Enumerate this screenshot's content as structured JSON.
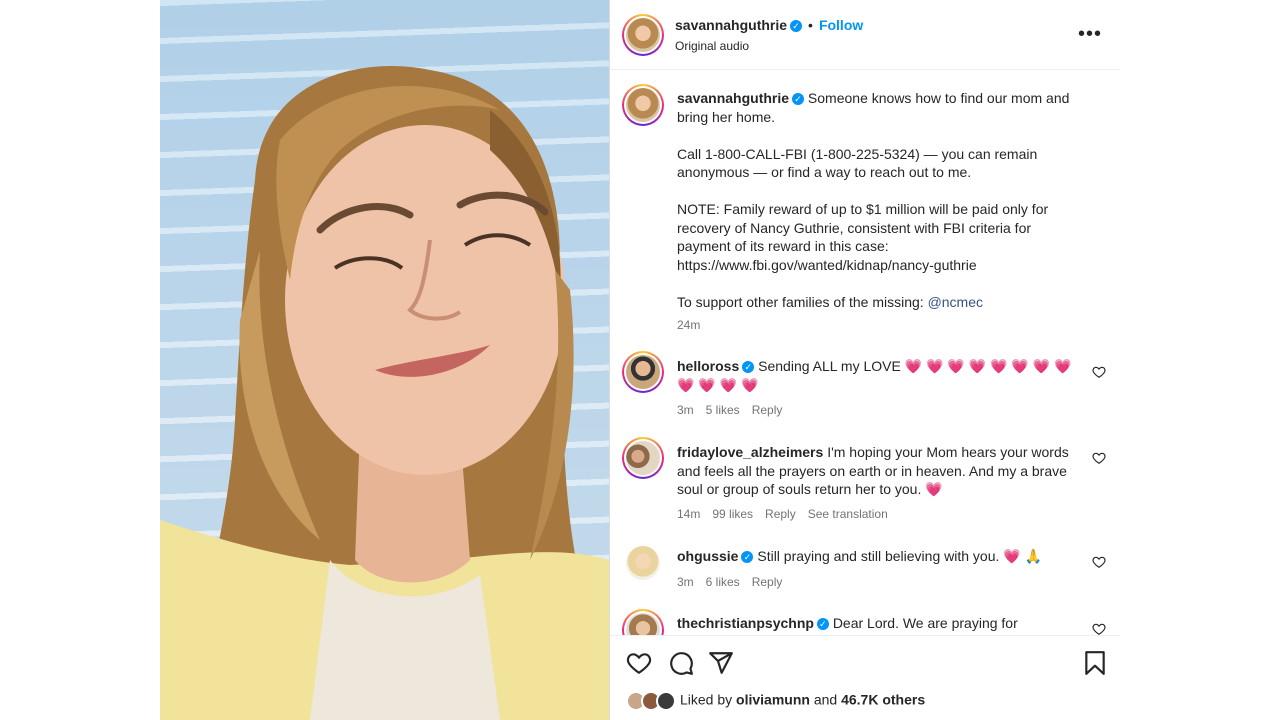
{
  "header": {
    "username": "savannahguthrie",
    "follow_label": "Follow",
    "audio": "Original audio",
    "more_label": "•••"
  },
  "caption": {
    "username": "savannahguthrie",
    "line1": "Someone knows how to find our mom and bring her home.",
    "line2": "Call 1-800-CALL-FBI (1-800-225-5324) — you can remain anonymous — or find a way to reach out to me.",
    "line3": "NOTE: Family reward of up to $1 million will be paid only for recovery of Nancy Guthrie, consistent with FBI criteria for payment of its reward in this case: https://www.fbi.gov/wanted/kidnap/nancy-guthrie",
    "line4_prefix": "To support other families of the missing: ",
    "line4_mention": "@ncmec",
    "time": "24m"
  },
  "comments": [
    {
      "username": "helloross",
      "text": "Sending ALL my LOVE",
      "emojis": "💗 💗 💗 💗 💗 💗 💗 💗 💗 💗 💗 💗",
      "time": "3m",
      "likes": "5 likes",
      "reply": "Reply"
    },
    {
      "username": "fridaylove_alzheimers",
      "text": "I'm hoping your Mom hears your words and feels all the prayers on earth or in heaven. And my a brave soul or group of souls return her to you.",
      "emojis": "💗",
      "time": "14m",
      "likes": "99 likes",
      "reply": "Reply",
      "translate": "See translation"
    },
    {
      "username": "ohgussie",
      "text": "Still praying and still believing with you.",
      "emojis": "💗 🙏",
      "time": "3m",
      "likes": "6 likes",
      "reply": "Reply"
    },
    {
      "username": "thechristianpsychnp",
      "text": "Dear Lord. We are praying for"
    }
  ],
  "footer": {
    "liked_by_prefix": "Liked by ",
    "liked_by_user": "oliviamunn",
    "liked_by_middle": " and ",
    "liked_by_count": "46.7K others"
  },
  "colors": {
    "accent": "#0095f6",
    "heart_emoji": "#f0478f"
  }
}
